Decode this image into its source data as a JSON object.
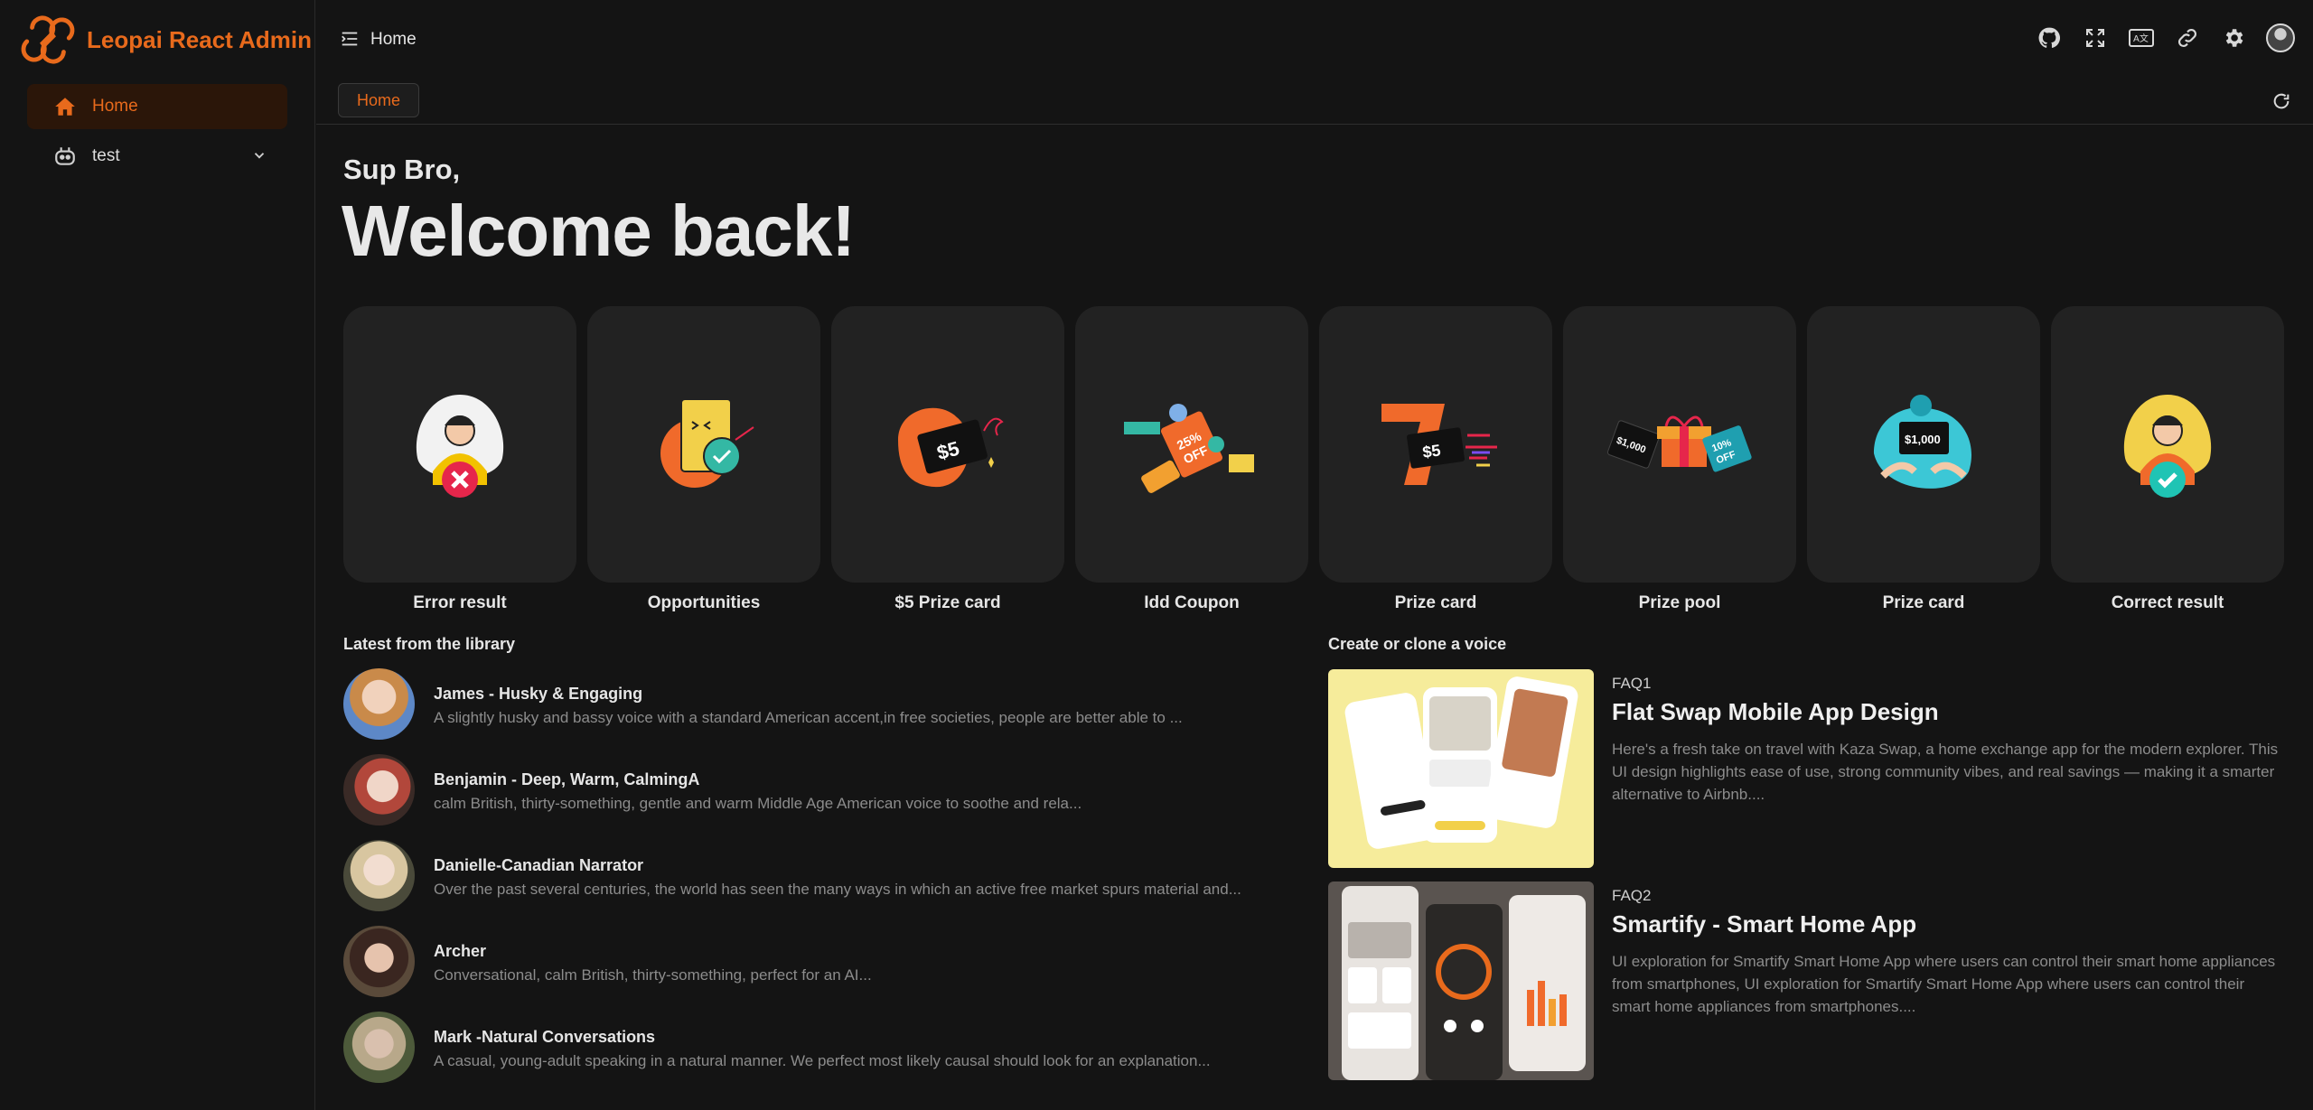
{
  "app": {
    "name": "Leopai React Admin"
  },
  "sidebar": {
    "items": [
      {
        "label": "Home",
        "icon": "home-icon",
        "active": true
      },
      {
        "label": "test",
        "icon": "bot-icon",
        "active": false
      }
    ]
  },
  "header": {
    "title": "Home"
  },
  "tabs": [
    {
      "label": "Home"
    }
  ],
  "colors": {
    "accent": "#e86a1c",
    "background": "#141414",
    "card": "#222222"
  },
  "main": {
    "greeting": "Sup Bro,",
    "welcome": "Welcome back!",
    "cards": [
      {
        "label": "Error result",
        "icon": "error-illustration"
      },
      {
        "label": "Opportunities",
        "icon": "opportunities-illustration"
      },
      {
        "label": "$5 Prize card",
        "icon": "prize-card-5-illustration"
      },
      {
        "label": "Idd Coupon",
        "icon": "coupon-illustration"
      },
      {
        "label": "Prize card",
        "icon": "prize-card-illustration"
      },
      {
        "label": "Prize pool",
        "icon": "prize-pool-illustration"
      },
      {
        "label": "Prize card",
        "icon": "prize-card-1000-illustration"
      },
      {
        "label": "Correct result",
        "icon": "correct-illustration"
      }
    ],
    "library": {
      "title": "Latest from the library",
      "items": [
        {
          "name": "James - Husky & Engaging",
          "desc": "A slightly husky and bassy voice with a standard American accent,in free societies, people are better able to ..."
        },
        {
          "name": "Benjamin - Deep, Warm, CalmingA",
          "desc": "calm British, thirty-something, gentle and warm Middle Age American voice to soothe and rela..."
        },
        {
          "name": "Danielle-Canadian Narrator",
          "desc": "Over the past several centuries, the world has seen the many ways in which an active free market spurs material and..."
        },
        {
          "name": "Archer",
          "desc": "Conversational, calm British, thirty-something, perfect for an AI..."
        },
        {
          "name": "Mark -Natural Conversations",
          "desc": "A casual, young-adult speaking in a natural manner. We perfect most likely causal should look for an explanation..."
        }
      ]
    },
    "voice": {
      "title": "Create or clone a voice",
      "items": [
        {
          "tag": "FAQ1",
          "title": "Flat Swap Mobile App Design",
          "desc": "Here's a fresh take on travel with Kaza Swap, a home exchange app for the modern explorer. This UI design highlights ease of use, strong community vibes, and real savings — making it a smarter alternative to Airbnb...."
        },
        {
          "tag": "FAQ2",
          "title": "Smartify - Smart Home App",
          "desc": "UI exploration for Smartify Smart Home App where users can control their smart home appliances from smartphones, UI exploration for Smartify Smart Home App where users can control their smart home appliances from smartphones...."
        }
      ]
    }
  }
}
